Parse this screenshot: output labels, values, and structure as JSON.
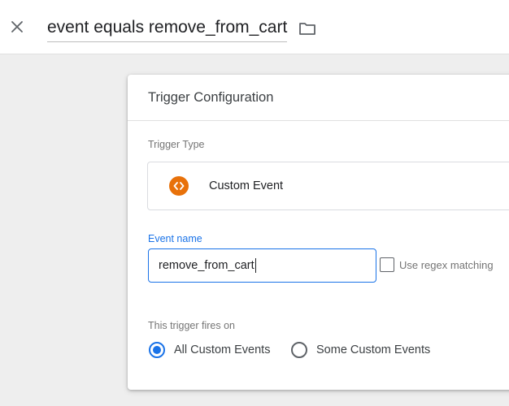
{
  "header": {
    "title": "event equals remove_from_cart",
    "close_icon": "close-icon",
    "folder_icon": "folder-icon"
  },
  "card": {
    "title": "Trigger Configuration",
    "trigger_type_label": "Trigger Type",
    "trigger_type": {
      "name": "Custom Event",
      "icon": "code-brackets-icon",
      "icon_color": "#e8710a"
    },
    "event_name": {
      "label": "Event name",
      "value": "remove_from_cart"
    },
    "regex": {
      "label": "Use regex matching",
      "checked": false
    },
    "fires_on": {
      "label": "This trigger fires on",
      "options": [
        {
          "label": "All Custom Events",
          "selected": true
        },
        {
          "label": "Some Custom Events",
          "selected": false
        }
      ]
    }
  },
  "colors": {
    "accent": "#1a73e8",
    "background": "#eeeeee"
  }
}
